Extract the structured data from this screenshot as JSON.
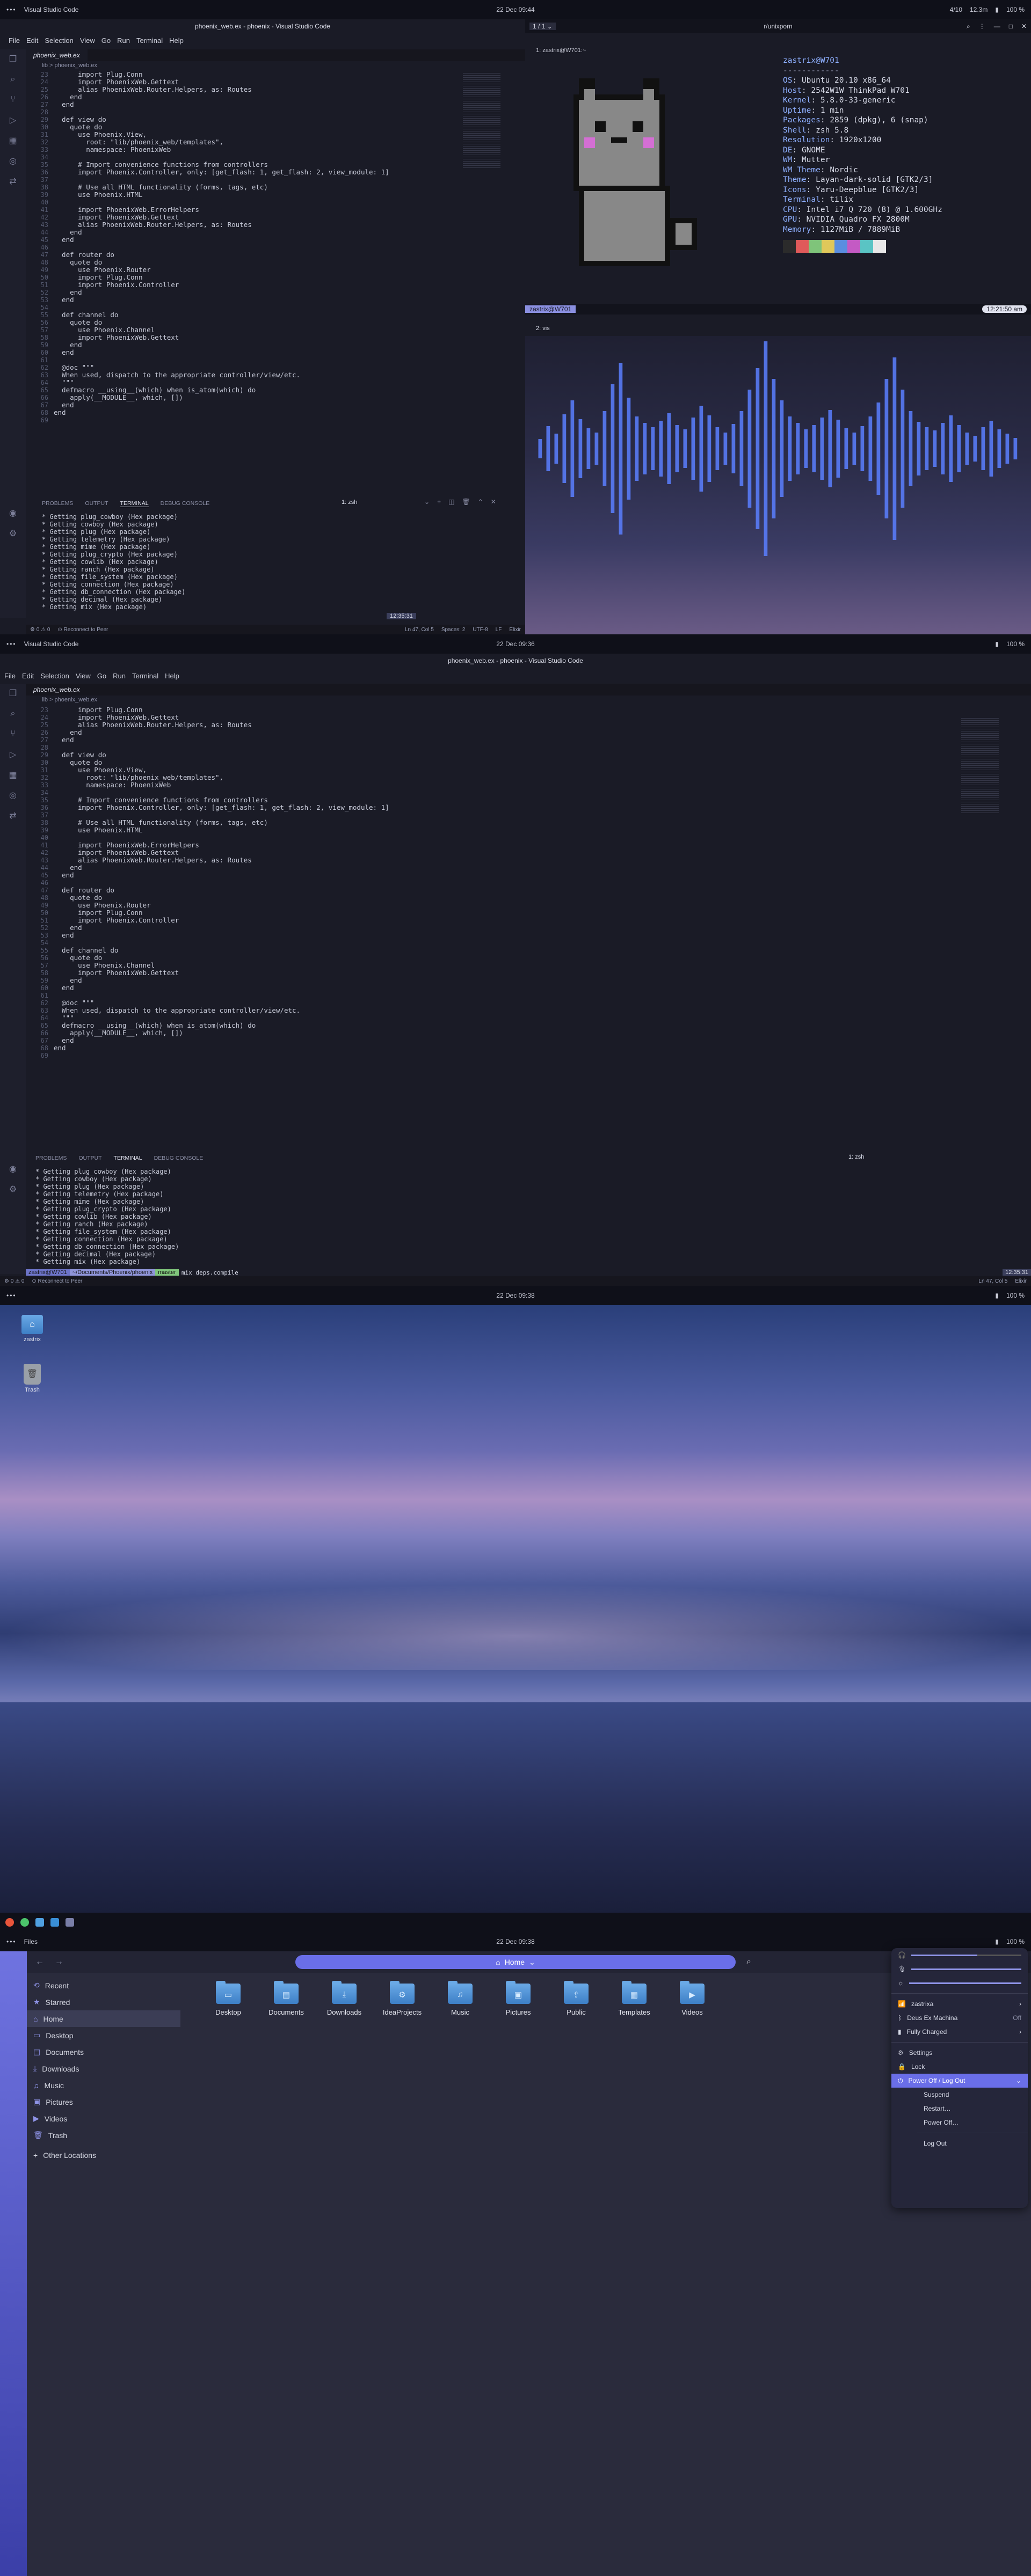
{
  "panel1": {
    "app": "Visual Studio Code",
    "clock": "22 Dec 09:44",
    "right1": "4/10",
    "right2": "12.3m",
    "battery": "100 %"
  },
  "vscode1": {
    "title": "phoenix_web.ex - phoenix - Visual Studio Code",
    "menu": [
      "File",
      "Edit",
      "Selection",
      "View",
      "Go",
      "Run",
      "Terminal",
      "Help"
    ],
    "tab": "phoenix_web.ex",
    "breadcrumb": "lib > phoenix_web.ex",
    "term_tabs": [
      "PROBLEMS",
      "OUTPUT",
      "TERMINAL",
      "DEBUG CONSOLE"
    ],
    "term_select": "1: zsh",
    "status": [
      "⚙ 0 ⚠ 0",
      "⊙ Reconnect to Peer",
      "Ln 47, Col 5",
      "Spaces: 2",
      "UTF-8",
      "LF",
      "Elixir"
    ]
  },
  "code": {
    "gutter": "23\n24\n25\n26\n27\n28\n29\n30\n31\n32\n33\n34\n35\n36\n37\n38\n39\n40\n41\n42\n43\n44\n45\n46\n47\n48\n49\n50\n51\n52\n53\n54\n55\n56\n57\n58\n59\n60\n61\n62\n63\n64\n65\n66\n67\n68\n69",
    "text": "      import Plug.Conn\n      import PhoenixWeb.Gettext\n      alias PhoenixWeb.Router.Helpers, as: Routes\n    end\n  end\n\n  def view do\n    quote do\n      use Phoenix.View,\n        root: \"lib/phoenix_web/templates\",\n        namespace: PhoenixWeb\n\n      # Import convenience functions from controllers\n      import Phoenix.Controller, only: [get_flash: 1, get_flash: 2, view_module: 1]\n\n      # Use all HTML functionality (forms, tags, etc)\n      use Phoenix.HTML\n\n      import PhoenixWeb.ErrorHelpers\n      import PhoenixWeb.Gettext\n      alias PhoenixWeb.Router.Helpers, as: Routes\n    end\n  end\n\n  def router do\n    quote do\n      use Phoenix.Router\n      import Plug.Conn\n      import Phoenix.Controller\n    end\n  end\n\n  def channel do\n    quote do\n      use Phoenix.Channel\n      import PhoenixWeb.Gettext\n    end\n  end\n\n  @doc \"\"\"\n  When used, dispatch to the appropriate controller/view/etc.\n  \"\"\"\n  defmacro __using__(which) when is_atom(which) do\n    apply(__MODULE__, which, [])\n  end\nend"
  },
  "terminal": {
    "lines": "* Getting plug_cowboy (Hex package)\n* Getting cowboy (Hex package)\n* Getting plug (Hex package)\n* Getting telemetry (Hex package)\n* Getting mime (Hex package)\n* Getting plug_crypto (Hex package)\n* Getting cowlib (Hex package)\n* Getting ranch (Hex package)\n* Getting file_system (Hex package)\n* Getting connection (Hex package)\n* Getting db_connection (Hex package)\n* Getting decimal (Hex package)\n* Getting mix (Hex package)",
    "prompt_user": "zastrix@W701",
    "prompt_path": "~/Documents/Phoenix/phoenix",
    "prompt_git": "master",
    "prompt_cmd": "mix deps.compile",
    "prompt_time": "12:35:31"
  },
  "tmux": {
    "pane1": "1: zastrix@W701:~",
    "title": "r/unixporn",
    "pane2": "2: vis",
    "clock": "12:21:50 am",
    "user": "zastrix@W701"
  },
  "neofetch": {
    "header": "zastrix@W701",
    "sep": "------------",
    "rows": [
      [
        "OS",
        "Ubuntu 20.10 x86_64"
      ],
      [
        "Host",
        "2542W1W ThinkPad W701"
      ],
      [
        "Kernel",
        "5.8.0-33-generic"
      ],
      [
        "Uptime",
        "1 min"
      ],
      [
        "Packages",
        "2859 (dpkg), 6 (snap)"
      ],
      [
        "Shell",
        "zsh 5.8"
      ],
      [
        "Resolution",
        "1920x1200"
      ],
      [
        "DE",
        "GNOME"
      ],
      [
        "WM",
        "Mutter"
      ],
      [
        "WM Theme",
        "Nordic"
      ],
      [
        "Theme",
        "Layan-dark-solid [GTK2/3]"
      ],
      [
        "Icons",
        "Yaru-Deepblue [GTK2/3]"
      ],
      [
        "Terminal",
        "tilix"
      ],
      [
        "CPU",
        "Intel i7 Q 720 (8) @ 1.600GHz"
      ],
      [
        "GPU",
        "NVIDIA Quadro FX 2800M"
      ],
      [
        "Memory",
        "1127MiB / 7889MiB"
      ]
    ],
    "swatches": [
      "#2b2b2b",
      "#e05a5a",
      "#7fc47a",
      "#e0c85a",
      "#5a8ee0",
      "#c45ac4",
      "#5ac4c4",
      "#e8e8e8"
    ]
  },
  "viz": {
    "bars": [
      18,
      42,
      28,
      64,
      90,
      55,
      38,
      30,
      70,
      120,
      160,
      95,
      60,
      48,
      40,
      52,
      66,
      44,
      36,
      58,
      80,
      62,
      40,
      30,
      46,
      70,
      110,
      150,
      200,
      130,
      90,
      60,
      48,
      36,
      44,
      58,
      72,
      54,
      38,
      30,
      42,
      60,
      86,
      130,
      170,
      110,
      70,
      50,
      40,
      34,
      48,
      62,
      44,
      30,
      24,
      40,
      52,
      36,
      28,
      20
    ]
  },
  "panel2": {
    "app": "Visual Studio Code",
    "clock": "22 Dec 09:36",
    "battery": "100 %"
  },
  "vscode2": {
    "title": "phoenix_web.ex - phoenix - Visual Studio Code",
    "term_select": "1: zsh"
  },
  "panel3": {
    "clock": "22 Dec 09:38",
    "battery": "100 %"
  },
  "desktop": {
    "icons": [
      "zastrix",
      "Trash"
    ]
  },
  "panel4": {
    "app": "Files",
    "clock": "22 Dec 09:38",
    "battery": "100 %"
  },
  "files": {
    "path": "Home",
    "sidebar": [
      "Recent",
      "Starred",
      "Home",
      "Desktop",
      "Documents",
      "Downloads",
      "Music",
      "Pictures",
      "Videos",
      "Trash"
    ],
    "other": "Other Locations",
    "folders": [
      "Desktop",
      "Documents",
      "Downloads",
      "IdeaProjects",
      "Music",
      "Pictures",
      "Public",
      "Templates",
      "Videos"
    ]
  },
  "popup": {
    "wifi": "zastrixa",
    "bt": "Deus Ex Machina",
    "bt_state": "Off",
    "battery": "Fully Charged",
    "settings": "Settings",
    "lock": "Lock",
    "power": "Power Off / Log Out",
    "sub": [
      "Suspend",
      "Restart…",
      "Power Off…",
      "Log Out"
    ]
  }
}
